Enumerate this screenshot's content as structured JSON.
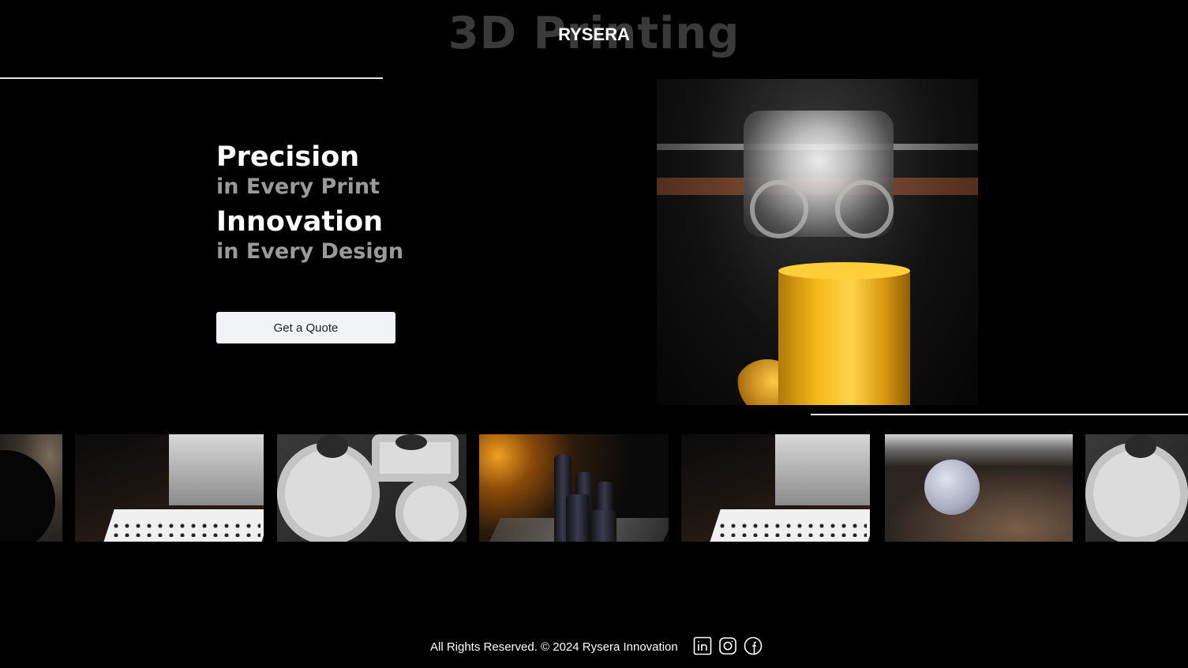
{
  "header": {
    "background_heading": "3D Printing",
    "brand": "RYSERA"
  },
  "hero": {
    "line1": "Precision",
    "line2": "in Every Print",
    "line3": "Innovation",
    "line4": "in Every Design",
    "cta_label": "Get a Quote"
  },
  "footer": {
    "copyright": "All Rights Reserved. © 2024 Rysera Innovation",
    "social": [
      "linkedin-icon",
      "instagram-icon",
      "facebook-icon"
    ]
  },
  "colors": {
    "background": "#000000",
    "text_primary": "#ffffff",
    "text_muted": "#9a9a9a",
    "button_bg": "#f1f3f6"
  }
}
